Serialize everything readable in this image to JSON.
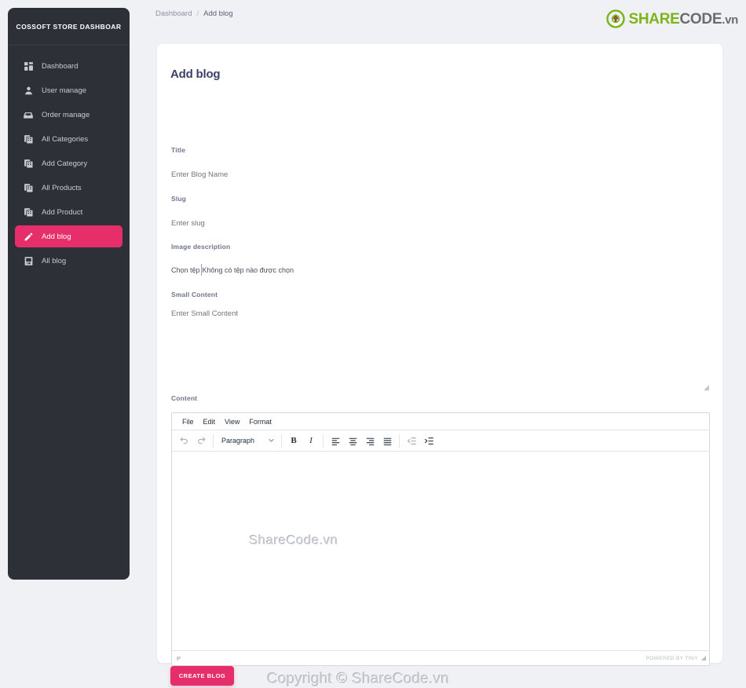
{
  "sidebar": {
    "brand": "COSSOFT STORE DASHBOAR",
    "active_index": 7,
    "items": [
      {
        "label": "Dashboard",
        "icon": "dashboard-grid-icon"
      },
      {
        "label": "User manage",
        "icon": "person-icon"
      },
      {
        "label": "Order manage",
        "icon": "inbox-tray-icon"
      },
      {
        "label": "All Categories",
        "icon": "layers-copy-icon"
      },
      {
        "label": "Add Category",
        "icon": "layers-copy-icon"
      },
      {
        "label": "All Products",
        "icon": "layers-copy-icon"
      },
      {
        "label": "Add Product",
        "icon": "layers-copy-icon"
      },
      {
        "label": "Add blog",
        "icon": "pencil-icon"
      },
      {
        "label": "All blog",
        "icon": "book-reader-icon"
      }
    ]
  },
  "topbar": {
    "breadcrumb": {
      "root": "Dashboard",
      "separator": "/",
      "current": "Add blog"
    },
    "logo": {
      "mark": "sharecode-recycle-icon",
      "part1": "SHARE",
      "part2": "CODE",
      "part3": ".vn"
    }
  },
  "card": {
    "title": "Add blog",
    "fields": {
      "title": {
        "label": "Title",
        "placeholder": "Enter Blog Name",
        "value": ""
      },
      "slug": {
        "label": "Slug",
        "placeholder": "Enter slug",
        "value": ""
      },
      "image_description": {
        "label": "Image description",
        "choose_button": "Chọn tệp",
        "status": "Không có tệp nào được chọn"
      },
      "small_content": {
        "label": "Small Content",
        "placeholder": "Enter Small Content",
        "value": ""
      },
      "content": {
        "label": "Content"
      }
    },
    "editor": {
      "menubar": [
        "File",
        "Edit",
        "View",
        "Format"
      ],
      "toolbar": {
        "undo": "undo-icon",
        "redo": "redo-icon",
        "format_select": "Paragraph",
        "bold": "B",
        "italic": "I",
        "align_left": "align-left-icon",
        "align_center": "align-center-icon",
        "align_right": "align-right-icon",
        "align_justify": "align-justify-icon",
        "outdent": "outdent-icon",
        "indent": "indent-icon"
      },
      "body_watermark": "ShareCode.vn",
      "statusbar": {
        "element_path": "P",
        "brand": "POWERED BY TINY"
      }
    },
    "submit_button": "CREATE BLOG",
    "copyright_watermark": "Copyright © ShareCode.vn"
  },
  "colors": {
    "accent_pink": "#e62e6b",
    "sidebar_bg": "#2e3038",
    "page_bg": "#f0f1f5",
    "logo_green": "#7cb518",
    "logo_gray": "#6b6b6b",
    "heading": "#3b4167"
  }
}
